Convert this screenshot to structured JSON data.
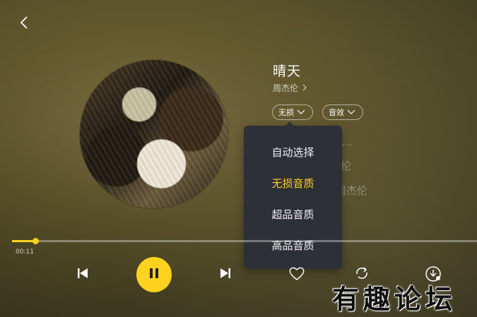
{
  "header": {
    "back_icon": "chevron-left-icon"
  },
  "song": {
    "title": "晴天",
    "artist": "周杰伦"
  },
  "pills": {
    "quality_label": "无损",
    "effects_label": "音效"
  },
  "lyrics": [
    "...",
    "...伦",
    "周杰伦"
  ],
  "quality_menu": {
    "items": [
      {
        "label": "自动选择",
        "active": false
      },
      {
        "label": "无损音质",
        "active": true
      },
      {
        "label": "超品音质",
        "active": false
      },
      {
        "label": "高品音质",
        "active": false
      }
    ]
  },
  "playback": {
    "elapsed": "00:11",
    "progress": 0.05,
    "state": "playing"
  },
  "controls": {
    "prev_icon": "skip-previous-icon",
    "play_icon": "pause-icon",
    "next_icon": "skip-next-icon",
    "favorite_icon": "heart-icon",
    "repeat_icon": "repeat-icon",
    "download_icon": "download-icon"
  },
  "watermark": {
    "text": "有趣论坛"
  },
  "colors": {
    "accent": "#ffd21f",
    "menu_bg": "#2e3038"
  }
}
